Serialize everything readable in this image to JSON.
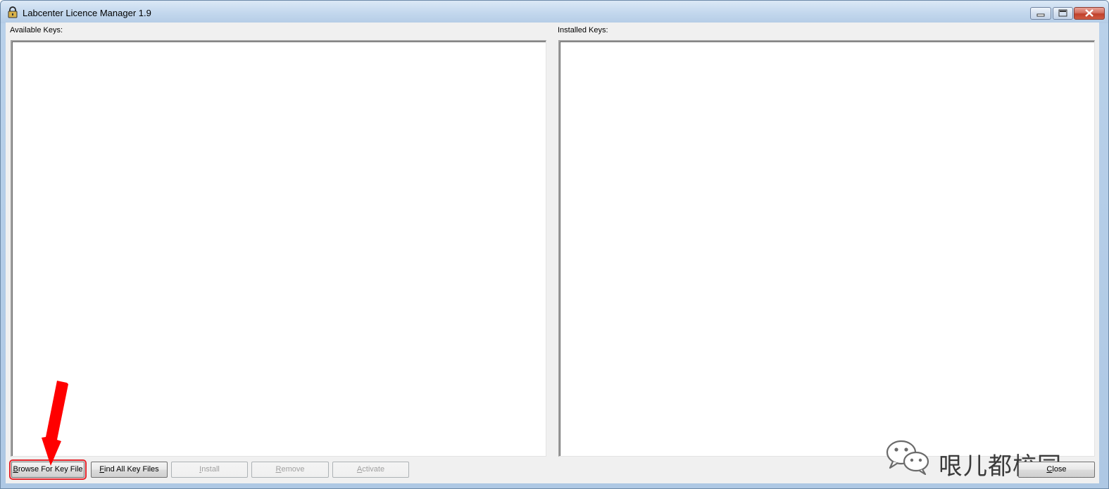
{
  "window": {
    "title": "Labcenter Licence Manager 1.9",
    "icon": "padlock-icon"
  },
  "caption_buttons": {
    "minimize_icon": "minimize-icon",
    "maximize_icon": "maximize-icon",
    "close_icon": "close-icon"
  },
  "panels": {
    "available_label": "Available Keys:",
    "installed_label": "Installed Keys:"
  },
  "buttons": {
    "browse": {
      "before": "",
      "mnemonic": "B",
      "after": "rowse For Key File"
    },
    "find_all": {
      "before": "",
      "mnemonic": "F",
      "after": "ind All Key Files"
    },
    "install": {
      "before": "",
      "mnemonic": "I",
      "after": "nstall"
    },
    "remove": {
      "before": "",
      "mnemonic": "R",
      "after": "emove"
    },
    "activate": {
      "before": "",
      "mnemonic": "A",
      "after": "ctivate"
    },
    "close": {
      "before": "",
      "mnemonic": "C",
      "after": "lose"
    }
  },
  "annotation": {
    "highlight_color": "#e3242b",
    "arrow_color": "#ff0000"
  },
  "watermark": {
    "text": "哏儿都校园",
    "icon": "wechat-icon"
  }
}
